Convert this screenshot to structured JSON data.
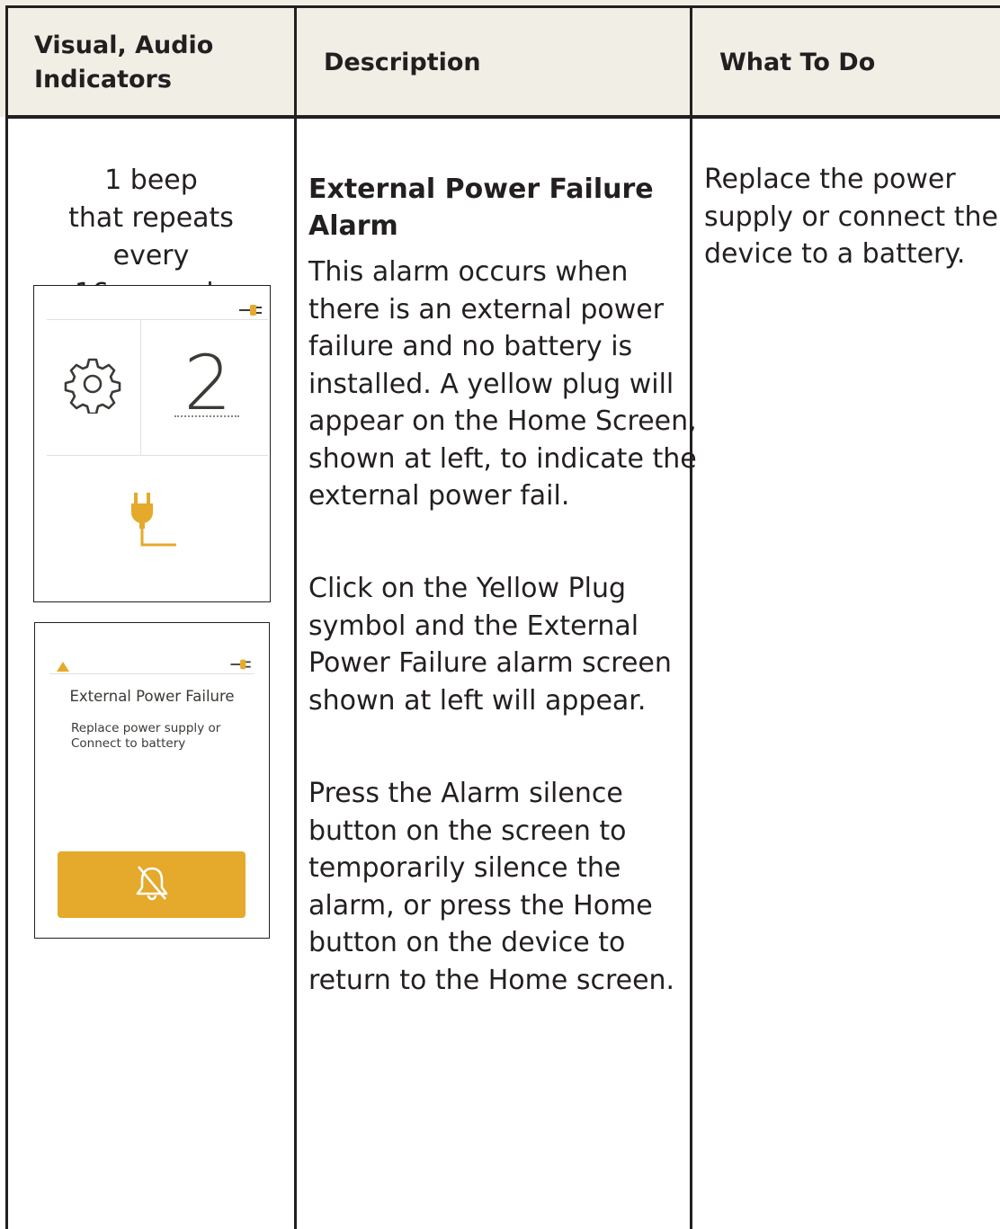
{
  "table": {
    "headers": {
      "col1": [
        "Visual, Audio",
        "Indicators"
      ],
      "col2": "Description",
      "col3": "What To Do"
    }
  },
  "indicators": {
    "beep_lines": [
      "1 beep",
      "that repeats every",
      "16 seconds"
    ]
  },
  "home_screen": {
    "value": "2",
    "icons": [
      "plug-icon",
      "gear-icon",
      "yellow-plug-icon"
    ],
    "plug_color": "#e5a92b"
  },
  "alarm_screen": {
    "title": "External Power Failure",
    "subtitle_lines": [
      "Replace power supply or",
      "Connect to battery"
    ],
    "icons": [
      "warning-triangle-icon",
      "plug-icon",
      "bell-silenced-icon"
    ],
    "button_color": "#e5a92b"
  },
  "description": {
    "title_lines": [
      "External Power Failure",
      "Alarm"
    ],
    "paragraph1": [
      "This alarm occurs when",
      "there is an external power",
      "failure and no battery is",
      "installed. A yellow plug will",
      "appear on the Home Screen,",
      "shown at left, to indicate the",
      "external power fail."
    ],
    "paragraph2": [
      "Click on the Yellow Plug",
      "symbol and the External",
      "Power Failure alarm screen",
      "shown at left will appear."
    ],
    "paragraph3": [
      "Press the Alarm silence",
      "button on the screen to",
      "temporarily silence the",
      "alarm, or press the Home",
      "button on the device to",
      "return to the Home screen."
    ]
  },
  "what_to_do": {
    "lines": [
      "Replace the power",
      "supply or connect the",
      "device to a battery."
    ]
  },
  "colors": {
    "header_bg": "#f1eee6",
    "rule": "#231f20",
    "accent": "#e5a92b"
  }
}
